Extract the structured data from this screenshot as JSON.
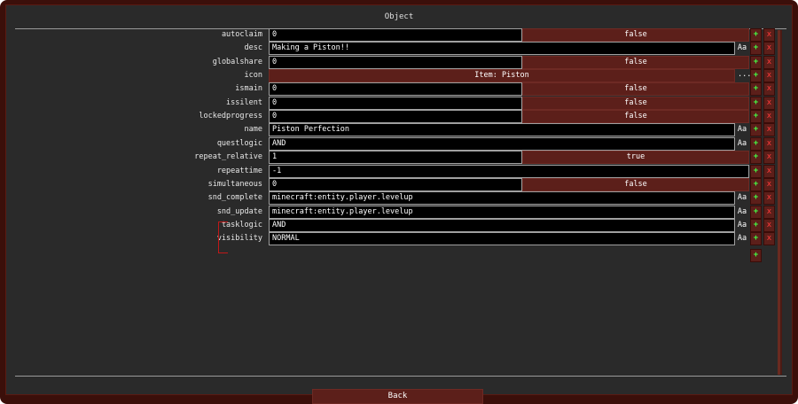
{
  "window": {
    "title": "Object",
    "back_label": "Back"
  },
  "icons": {
    "add": "+",
    "remove": "x",
    "text_mode": "Aa",
    "more": "..."
  },
  "rows": [
    {
      "name": "autoclaim",
      "value": "0",
      "toggle": "false"
    },
    {
      "name": "desc",
      "value": "Making a Piston!!"
    },
    {
      "name": "globalshare",
      "value": "0",
      "toggle": "false"
    },
    {
      "name": "icon",
      "item": "Item: Piston"
    },
    {
      "name": "ismain",
      "value": "0",
      "toggle": "false"
    },
    {
      "name": "issilent",
      "value": "0",
      "toggle": "false"
    },
    {
      "name": "lockedprogress",
      "value": "0",
      "toggle": "false"
    },
    {
      "name": "name",
      "value": "Piston Perfection"
    },
    {
      "name": "questlogic",
      "value": "AND"
    },
    {
      "name": "repeat_relative",
      "value": "1",
      "toggle": "true"
    },
    {
      "name": "repeattime",
      "value": "-1"
    },
    {
      "name": "simultaneous",
      "value": "0",
      "toggle": "false"
    },
    {
      "name": "snd_complete",
      "value": "minecraft:entity.player.levelup"
    },
    {
      "name": "snd_update",
      "value": "minecraft:entity.player.levelup"
    },
    {
      "name": "tasklogic",
      "value": "AND"
    },
    {
      "name": "visibility",
      "value": "NORMAL"
    }
  ],
  "colors": {
    "panel": "#2a2a2a",
    "frame": "#3b0f0a",
    "toggle_bg": "#5c1f1a",
    "add": "#44ff44",
    "remove": "#ff3b3b",
    "annotation": "#c01818"
  }
}
